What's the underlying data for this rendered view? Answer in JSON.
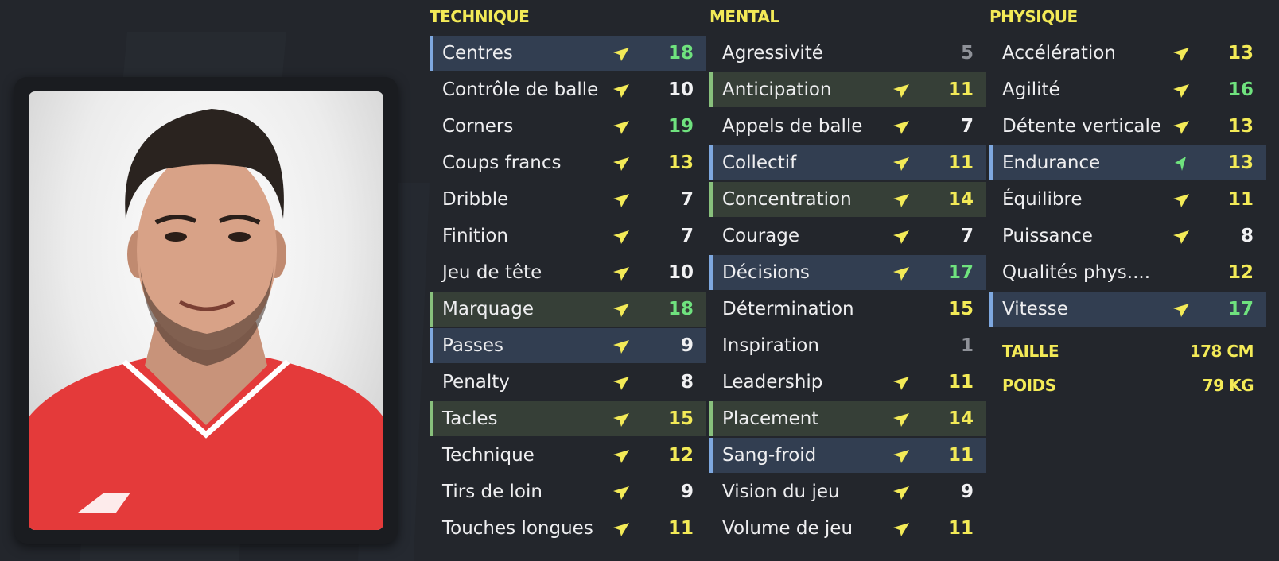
{
  "colors": {
    "background": "#23262c",
    "highlight_blue": "#323e51",
    "highlight_green": "#363f37",
    "accent_yellow": "#f3ea57",
    "accent_green": "#6fe27e",
    "jersey_red": "#e43a3a"
  },
  "player_photo": {
    "icon": "player-portrait"
  },
  "technique": {
    "title": "TECHNIQUE",
    "rows": [
      {
        "label": "Centres",
        "value": "18",
        "level": "green",
        "highlight": "blue",
        "arrow": "yellow"
      },
      {
        "label": "Contrôle de balle",
        "value": "10",
        "level": "white",
        "highlight": "",
        "arrow": "yellow"
      },
      {
        "label": "Corners",
        "value": "19",
        "level": "green",
        "highlight": "",
        "arrow": "yellow"
      },
      {
        "label": "Coups francs",
        "value": "13",
        "level": "yellow",
        "highlight": "",
        "arrow": "yellow"
      },
      {
        "label": "Dribble",
        "value": "7",
        "level": "white",
        "highlight": "",
        "arrow": "yellow"
      },
      {
        "label": "Finition",
        "value": "7",
        "level": "white",
        "highlight": "",
        "arrow": "yellow"
      },
      {
        "label": "Jeu de tête",
        "value": "10",
        "level": "white",
        "highlight": "",
        "arrow": "yellow"
      },
      {
        "label": "Marquage",
        "value": "18",
        "level": "green",
        "highlight": "green",
        "arrow": "yellow"
      },
      {
        "label": "Passes",
        "value": "9",
        "level": "white",
        "highlight": "blue",
        "arrow": "yellow"
      },
      {
        "label": "Penalty",
        "value": "8",
        "level": "white",
        "highlight": "",
        "arrow": "yellow"
      },
      {
        "label": "Tacles",
        "value": "15",
        "level": "yellow",
        "highlight": "green",
        "arrow": "yellow"
      },
      {
        "label": "Technique",
        "value": "12",
        "level": "yellow",
        "highlight": "",
        "arrow": "yellow"
      },
      {
        "label": "Tirs de loin",
        "value": "9",
        "level": "white",
        "highlight": "",
        "arrow": "yellow"
      },
      {
        "label": "Touches longues",
        "value": "11",
        "level": "yellow",
        "highlight": "",
        "arrow": "yellow"
      }
    ]
  },
  "mental": {
    "title": "MENTAL",
    "rows": [
      {
        "label": "Agressivité",
        "value": "5",
        "level": "grey",
        "highlight": "",
        "arrow": ""
      },
      {
        "label": "Anticipation",
        "value": "11",
        "level": "yellow",
        "highlight": "green",
        "arrow": "yellow"
      },
      {
        "label": "Appels de balle",
        "value": "7",
        "level": "white",
        "highlight": "",
        "arrow": "yellow"
      },
      {
        "label": "Collectif",
        "value": "11",
        "level": "yellow",
        "highlight": "blue",
        "arrow": "yellow"
      },
      {
        "label": "Concentration",
        "value": "14",
        "level": "yellow",
        "highlight": "green",
        "arrow": "yellow"
      },
      {
        "label": "Courage",
        "value": "7",
        "level": "white",
        "highlight": "",
        "arrow": "yellow"
      },
      {
        "label": "Décisions",
        "value": "17",
        "level": "green",
        "highlight": "blue",
        "arrow": "yellow"
      },
      {
        "label": "Détermination",
        "value": "15",
        "level": "yellow",
        "highlight": "",
        "arrow": ""
      },
      {
        "label": "Inspiration",
        "value": "1",
        "level": "grey",
        "highlight": "",
        "arrow": ""
      },
      {
        "label": "Leadership",
        "value": "11",
        "level": "yellow",
        "highlight": "",
        "arrow": "yellow"
      },
      {
        "label": "Placement",
        "value": "14",
        "level": "yellow",
        "highlight": "green",
        "arrow": "yellow"
      },
      {
        "label": "Sang-froid",
        "value": "11",
        "level": "yellow",
        "highlight": "blue",
        "arrow": "yellow"
      },
      {
        "label": "Vision du jeu",
        "value": "9",
        "level": "white",
        "highlight": "",
        "arrow": "yellow"
      },
      {
        "label": "Volume de jeu",
        "value": "11",
        "level": "yellow",
        "highlight": "",
        "arrow": "yellow"
      }
    ]
  },
  "physique": {
    "title": "PHYSIQUE",
    "rows": [
      {
        "label": "Accélération",
        "value": "13",
        "level": "yellow",
        "highlight": "",
        "arrow": "yellow"
      },
      {
        "label": "Agilité",
        "value": "16",
        "level": "green",
        "highlight": "",
        "arrow": "yellow"
      },
      {
        "label": "Détente verticale",
        "value": "13",
        "level": "yellow",
        "highlight": "",
        "arrow": "yellow"
      },
      {
        "label": "Endurance",
        "value": "13",
        "level": "yellow",
        "highlight": "blue",
        "arrow": "green"
      },
      {
        "label": "Équilibre",
        "value": "11",
        "level": "yellow",
        "highlight": "",
        "arrow": "yellow"
      },
      {
        "label": "Puissance",
        "value": "8",
        "level": "white",
        "highlight": "",
        "arrow": "yellow"
      },
      {
        "label": "Qualités phys....",
        "value": "12",
        "level": "yellow",
        "highlight": "",
        "arrow": ""
      },
      {
        "label": "Vitesse",
        "value": "17",
        "level": "green",
        "highlight": "blue",
        "arrow": "yellow"
      }
    ],
    "height_label": "TAILLE",
    "height_value": "178 CM",
    "weight_label": "POIDS",
    "weight_value": "79 KG"
  }
}
